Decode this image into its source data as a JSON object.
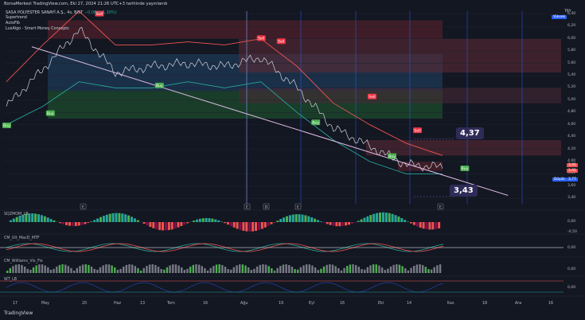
{
  "header": {
    "watermark": "BorsaMerkezi TradingView.com, Eki 27, 2024 21:26 UTC+3 tarihinde yayınlandı"
  },
  "symbol": {
    "label": "SASA POLYESTER SANAYİ A.Ş., 4s, BIST",
    "change": "−0,08 (−1,30%)"
  },
  "indicators": [
    "Supertrend",
    "AutoFib",
    "LuxAlgo - Smart Money Concepts"
  ],
  "price_axis": {
    "currency": "TRY",
    "ticks": [
      "6,40",
      "6,20",
      "6,00",
      "5,80",
      "5,60",
      "5,40",
      "5,20",
      "5,00",
      "4,80",
      "4,60",
      "4,40",
      "4,20",
      "4,00",
      "3,80",
      "3,60",
      "3,40"
    ]
  },
  "price_tags": {
    "high": "Yüksek",
    "last1": "3,91",
    "last2": "3,91",
    "low_label": "Düşük",
    "low_value": "3,77"
  },
  "annotations": {
    "upper": "4,37",
    "lower": "3,43"
  },
  "signal_labels": {
    "buy": "Buy",
    "sell": "Sell"
  },
  "subpanes": [
    {
      "name": "SQZMOM_LB",
      "ticks": [
        "0,00",
        "-0,50"
      ]
    },
    {
      "name": "CM_Ult_MacD_MTF",
      "ticks": [
        "0,00"
      ]
    },
    {
      "name": "CM_Williams_Vix_Fix",
      "ticks": [
        "0,00"
      ]
    },
    {
      "name": "WT_LB",
      "ticks": [
        "0,00"
      ]
    }
  ],
  "x_axis": {
    "ticks": [
      "17",
      "May",
      "20",
      "Haz",
      "13",
      "Tem",
      "16",
      "Ağu",
      "19",
      "Eyl",
      "16",
      "Eki",
      "14",
      "Kas",
      "18",
      "Ara",
      "16"
    ]
  },
  "markers": {
    "e": "E",
    "d": "D"
  },
  "footer": "TradingView",
  "colors": {
    "bg": "#131722",
    "up": "#26a69a",
    "down": "#ef5350",
    "buy": "#4caf50",
    "sell": "#f23645",
    "trend": "#e1bee7",
    "vline": "#2962ff"
  },
  "chart_data": {
    "type": "line",
    "title": "SASA POLYESTER SANAYİ A.Ş., 4s, BIST",
    "xlabel": "",
    "ylabel": "TRY",
    "ylim": [
      3.3,
      6.45
    ],
    "x": [
      "17",
      "May",
      "20",
      "Haz",
      "13",
      "Tem",
      "16",
      "Ağu",
      "19",
      "Eyl",
      "16",
      "Eki",
      "14"
    ],
    "series": [
      {
        "values": [
          4.9,
          5.5,
          6.15,
          5.45,
          5.55,
          5.6,
          5.55,
          5.7,
          5.2,
          4.55,
          4.25,
          3.95,
          3.91
        ]
      }
    ],
    "signals": {
      "buy_idx": [
        0.0,
        1.2,
        4.2,
        8.5,
        10.6,
        12.6
      ],
      "sell_idx": [
        2.55,
        7.0,
        7.55,
        10.05,
        11.3
      ],
      "buy_values": [
        4.7,
        4.9,
        5.35,
        4.75,
        4.2,
        4.0
      ],
      "sell_values": [
        6.3,
        5.9,
        5.85,
        4.95,
        4.4
      ]
    },
    "trendline": {
      "from": [
        0.7,
        5.87
      ],
      "to": [
        13.8,
        3.45
      ]
    },
    "annotations": [
      {
        "text": "4,37",
        "value": 4.37
      },
      {
        "text": "3,43",
        "value": 3.43
      }
    ]
  }
}
